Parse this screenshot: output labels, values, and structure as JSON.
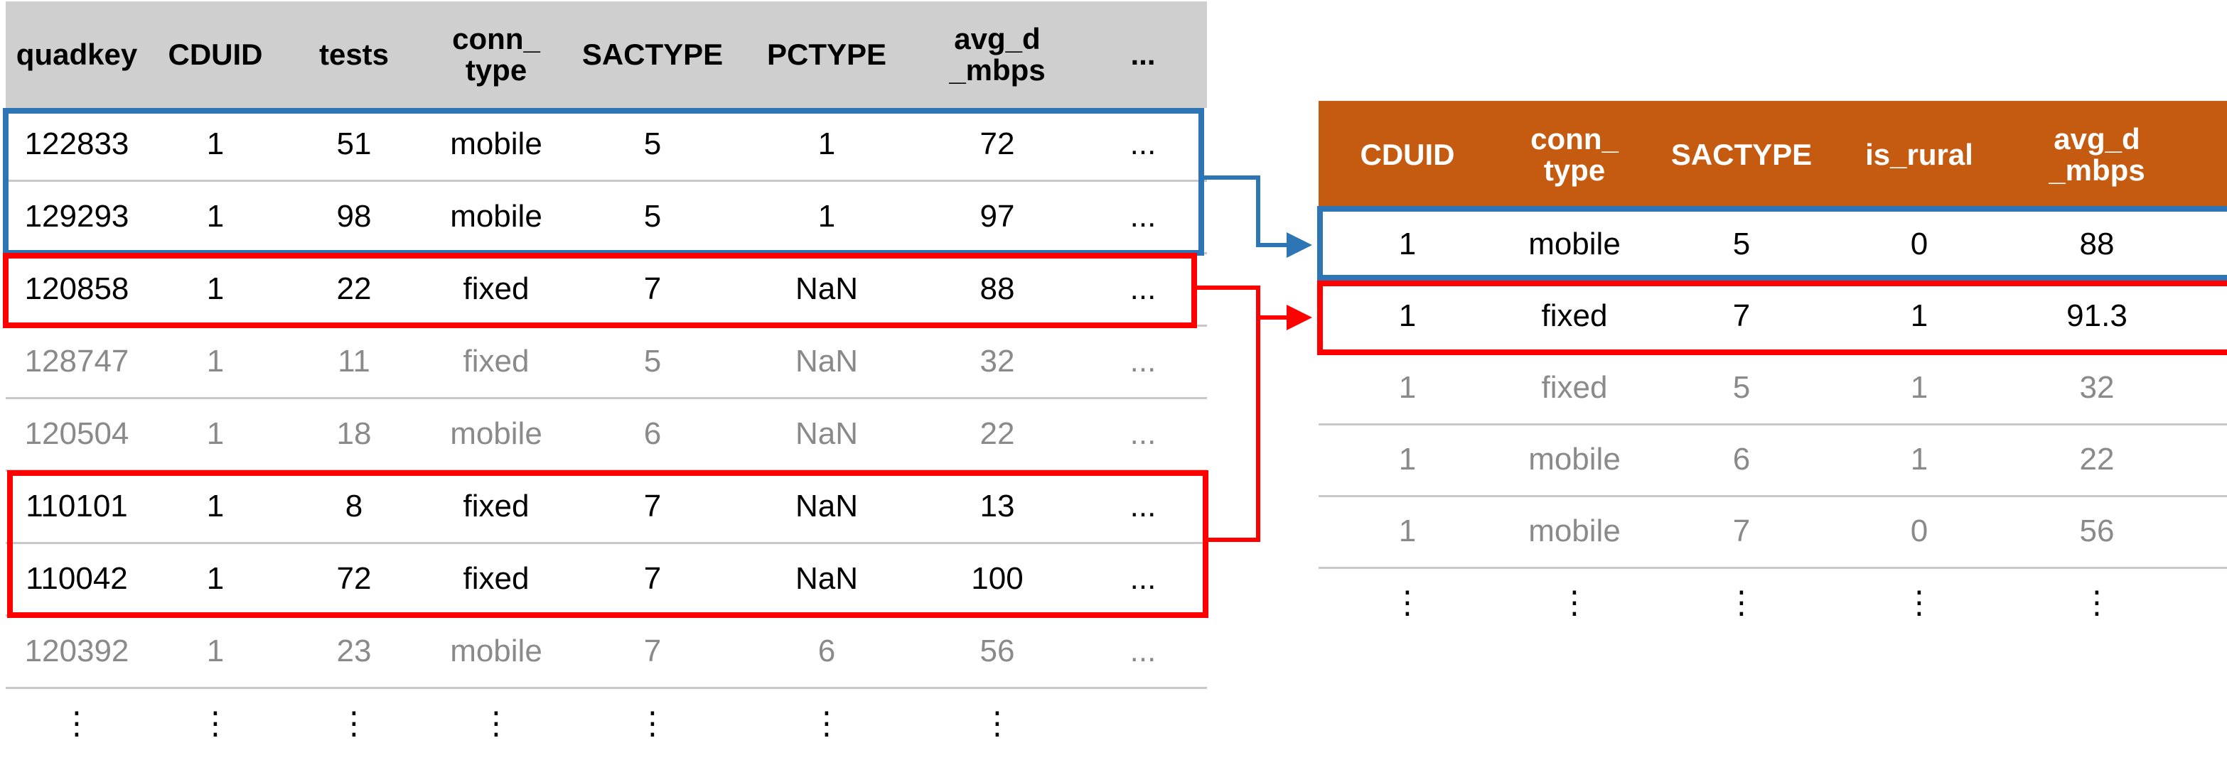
{
  "left_table": {
    "headers": [
      "quadkey",
      "CDUID",
      "tests",
      "conn_\ntype",
      "SACTYPE",
      "PCTYPE",
      "avg_d\n_mbps",
      "..."
    ],
    "rows": [
      {
        "cells": [
          "122833",
          "1",
          "51",
          "mobile",
          "5",
          "1",
          "72",
          "..."
        ],
        "dim": false
      },
      {
        "cells": [
          "129293",
          "1",
          "98",
          "mobile",
          "5",
          "1",
          "97",
          "..."
        ],
        "dim": false
      },
      {
        "cells": [
          "120858",
          "1",
          "22",
          "fixed",
          "7",
          "NaN",
          "88",
          "..."
        ],
        "dim": false
      },
      {
        "cells": [
          "128747",
          "1",
          "11",
          "fixed",
          "5",
          "NaN",
          "32",
          "..."
        ],
        "dim": true
      },
      {
        "cells": [
          "120504",
          "1",
          "18",
          "mobile",
          "6",
          "NaN",
          "22",
          "..."
        ],
        "dim": true
      },
      {
        "cells": [
          "110101",
          "1",
          "8",
          "fixed",
          "7",
          "NaN",
          "13",
          "..."
        ],
        "dim": false
      },
      {
        "cells": [
          "110042",
          "1",
          "72",
          "fixed",
          "7",
          "NaN",
          "100",
          "..."
        ],
        "dim": false
      },
      {
        "cells": [
          "120392",
          "1",
          "23",
          "mobile",
          "7",
          "6",
          "56",
          "..."
        ],
        "dim": true
      },
      {
        "cells": [
          "⋮",
          "⋮",
          "⋮",
          "⋮",
          "⋮",
          "⋮",
          "⋮",
          ""
        ],
        "dim": false
      }
    ]
  },
  "right_table": {
    "headers": [
      "CDUID",
      "conn_\ntype",
      "SACTYPE",
      "is_rural",
      "avg_d\n_mbps",
      "..."
    ],
    "rows": [
      {
        "cells": [
          "1",
          "mobile",
          "5",
          "0",
          "88",
          "..."
        ],
        "dim": false
      },
      {
        "cells": [
          "1",
          "fixed",
          "7",
          "1",
          "91.3",
          "..."
        ],
        "dim": false
      },
      {
        "cells": [
          "1",
          "fixed",
          "5",
          "1",
          "32",
          ""
        ],
        "dim": true
      },
      {
        "cells": [
          "1",
          "mobile",
          "6",
          "1",
          "22",
          ""
        ],
        "dim": true
      },
      {
        "cells": [
          "1",
          "mobile",
          "7",
          "0",
          "56",
          "..."
        ],
        "dim": true
      },
      {
        "cells": [
          "⋮",
          "⋮",
          "⋮",
          "⋮",
          "⋮",
          ""
        ],
        "dim": false
      }
    ]
  },
  "colors": {
    "left_header_bg": "#d0cfd0",
    "right_header_bg": "#c55a11",
    "mobile_group": "#2e75b6",
    "fixed_group": "#ff0000"
  }
}
